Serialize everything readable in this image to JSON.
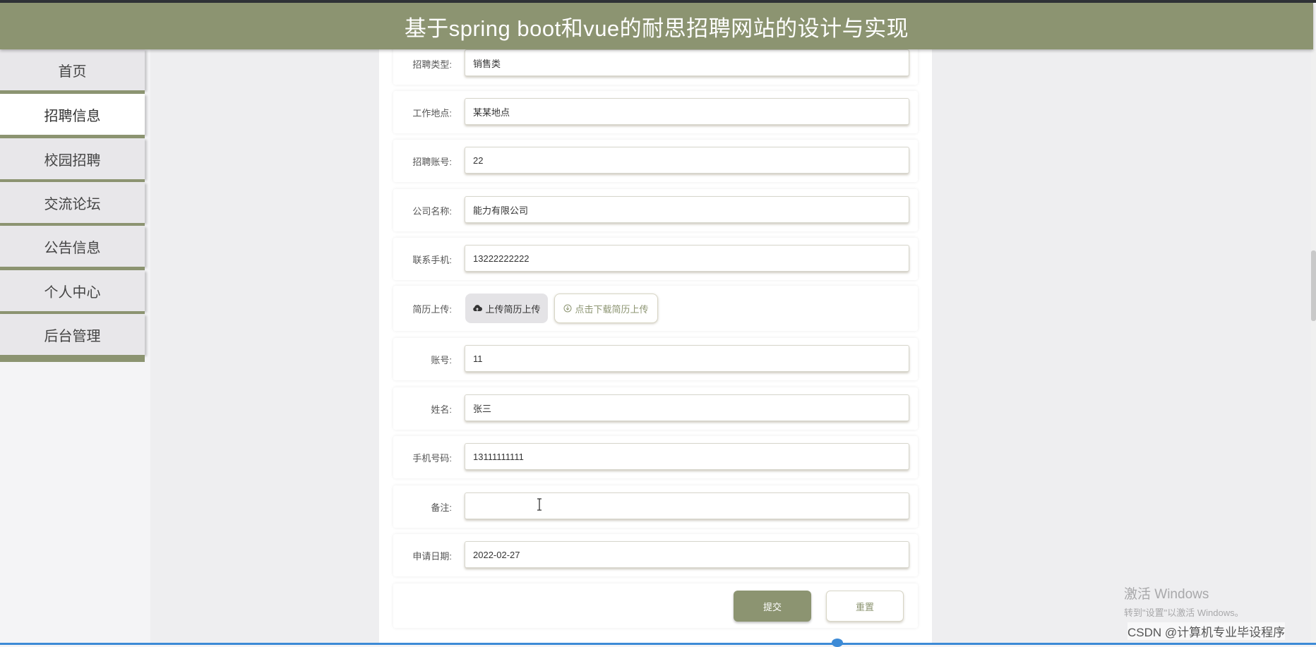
{
  "app": {
    "title": "基于spring boot和vue的耐思招聘网站的设计与实现"
  },
  "colors": {
    "accent": "#8c9471",
    "header_bg": "#8c9471",
    "page_bg": "#f4f4f6"
  },
  "sidebar": {
    "items": [
      {
        "label": "首页",
        "active": false
      },
      {
        "label": "招聘信息",
        "active": true
      },
      {
        "label": "校园招聘",
        "active": false
      },
      {
        "label": "交流论坛",
        "active": false
      },
      {
        "label": "公告信息",
        "active": false
      },
      {
        "label": "个人中心",
        "active": false
      },
      {
        "label": "后台管理",
        "active": false
      }
    ]
  },
  "form": {
    "fields": {
      "recruit_type": {
        "label": "招聘类型:",
        "value": "销售类"
      },
      "work_location": {
        "label": "工作地点:",
        "value": "某某地点"
      },
      "recruit_account": {
        "label": "招聘账号:",
        "value": "22"
      },
      "company_name": {
        "label": "公司名称:",
        "value": "能力有限公司"
      },
      "contact_phone": {
        "label": "联系手机:",
        "value": "13222222222"
      },
      "account": {
        "label": "账号:",
        "value": "11"
      },
      "name": {
        "label": "姓名:",
        "value": "张三"
      },
      "mobile": {
        "label": "手机号码:",
        "value": "13111111111"
      },
      "remark": {
        "label": "备注:",
        "value": ""
      },
      "apply_date": {
        "label": "申请日期:",
        "value": "2022-02-27"
      }
    },
    "resume": {
      "label": "简历上传:",
      "upload_label": "上传简历上传",
      "upload_icon": "cloud-upload-icon",
      "download_label": "点击下载简历上传",
      "download_icon": "download-circle-icon"
    },
    "actions": {
      "submit_label": "提交",
      "reset_label": "重置"
    }
  },
  "overlay": {
    "watermark_line1": "激活 Windows",
    "watermark_line2": "转到\"设置\"以激活 Windows。",
    "credit": "CSDN @计算机专业毕设程序"
  }
}
